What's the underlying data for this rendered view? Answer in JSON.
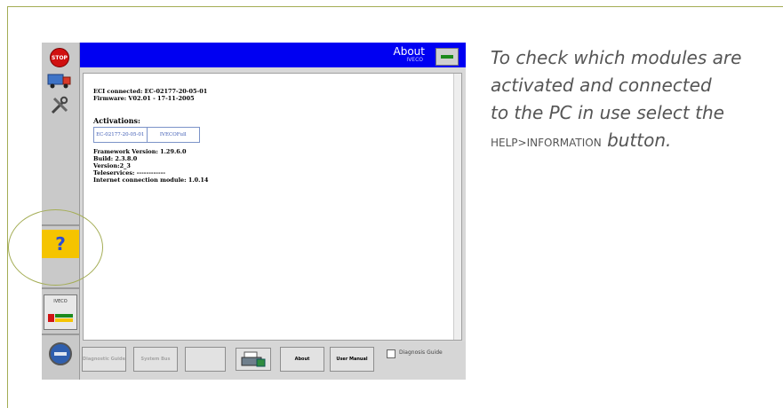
{
  "window": {
    "title": "About",
    "subtitle": "IVECO"
  },
  "sidebar": {
    "stop_label": "STOP",
    "iveco_label": "IVECO",
    "help_glyph": "?",
    "icons": [
      "stop-icon",
      "truck-icon",
      "tools-icon",
      "help-icon",
      "iveco-module-icon",
      "globe-icon"
    ]
  },
  "content": {
    "eci": "ECI connected: EC-02177-20-05-01",
    "firmware": "Firmware: V02.01 - 17-11-2005",
    "activations_title": "Activations:",
    "activations": [
      "EC-02177-20-05-01",
      "IVECOFull"
    ],
    "framework": "Framework Version: 1.29.6.0",
    "build": "Build: 2.3.8.0",
    "version": "Version:2_3",
    "teleservices": "Teleservices: ------------",
    "internet": "Internet connection module: 1.0.14"
  },
  "footer": {
    "diagnostic_guide": "Diagnostic Guide",
    "system_bus": "System Bus",
    "blank": "",
    "about": "About",
    "user_manual": "User Manual",
    "diagnosis_guide_label": "Diagnosis Guide"
  },
  "description": {
    "line1": "To check which modules are",
    "line2": "activated and connected",
    "line3": "to the PC in use select the",
    "help_word": "HELP",
    "gt": ">",
    "info_word": "INFORMATION",
    "button_word": "button."
  },
  "colors": {
    "titlebar": "#0000f2",
    "help_button": "#f5c400",
    "frame": "#a4ad55"
  }
}
